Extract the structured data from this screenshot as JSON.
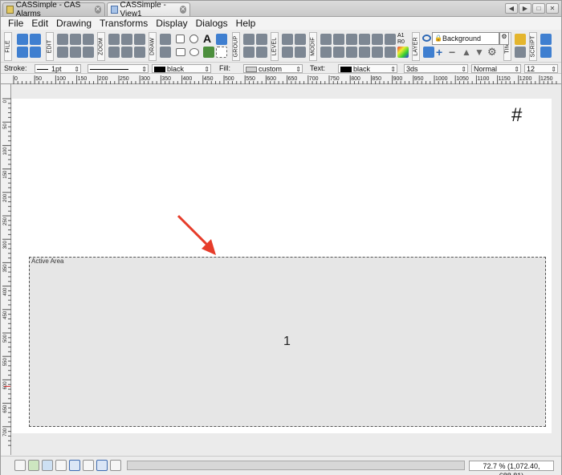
{
  "tabs": [
    {
      "label": "CASSimple - CAS Alarms"
    },
    {
      "label": "CASSimple - View1"
    }
  ],
  "window_controls": [
    "◀",
    "▶",
    "□",
    "✕"
  ],
  "menu": [
    "File",
    "Edit",
    "Drawing",
    "Transforms",
    "Display",
    "Dialogs",
    "Help"
  ],
  "toolbar_groups": [
    "FILE",
    "EDIT",
    "ZOOM",
    "DRAW",
    "GROUP",
    "LEVEL",
    "MODIF",
    "LAYER",
    "TIME",
    "SCRIPT"
  ],
  "toolbar_text": {
    "a1": "A1",
    "r0": "R0",
    "text_tool": "A"
  },
  "layer": {
    "value": "Background"
  },
  "properties": {
    "stroke_label": "Stroke:",
    "stroke_width": "1pt",
    "stroke_color": "black",
    "fill_label": "Fill:",
    "fill_value": "custom",
    "text_label": "Text:",
    "text_color": "black",
    "font": "3ds",
    "style": "Normal",
    "size": "12"
  },
  "ruler": {
    "h_ticks": [
      "0",
      "50",
      "100",
      "150",
      "200",
      "250",
      "300",
      "350",
      "400",
      "450",
      "500",
      "550",
      "600",
      "650",
      "700",
      "750",
      "800",
      "850",
      "900",
      "950",
      "1000",
      "1050",
      "1100",
      "1150",
      "1200",
      "1250"
    ],
    "v_ticks": [
      "0",
      "50",
      "100",
      "150",
      "200",
      "250",
      "300",
      "350",
      "400",
      "450",
      "500",
      "550",
      "600",
      "650",
      "700"
    ]
  },
  "canvas": {
    "hash_symbol": "#",
    "active_area_label": "Active Area",
    "active_area_value": "1"
  },
  "status": {
    "zoom_coords": "72.7 % (1,072.40, 688.81)"
  },
  "colors": {
    "accent": "#3f7fd0",
    "arrow": "#e63c2a",
    "active_area_bg": "#e6e6e6"
  }
}
